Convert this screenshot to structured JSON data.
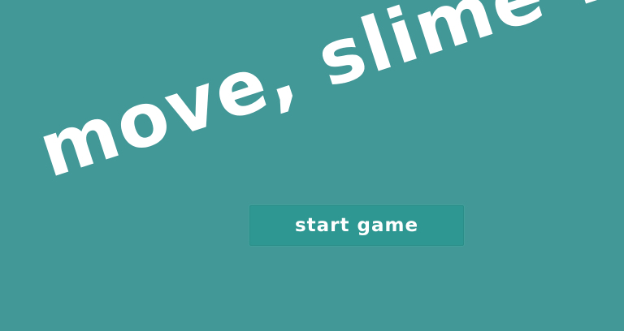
{
  "screen": {
    "title": "move, slime !",
    "start_button_label": "start game"
  },
  "theme": {
    "background": "#429797",
    "button_background": "#2e9791",
    "text": "#ffffff"
  }
}
